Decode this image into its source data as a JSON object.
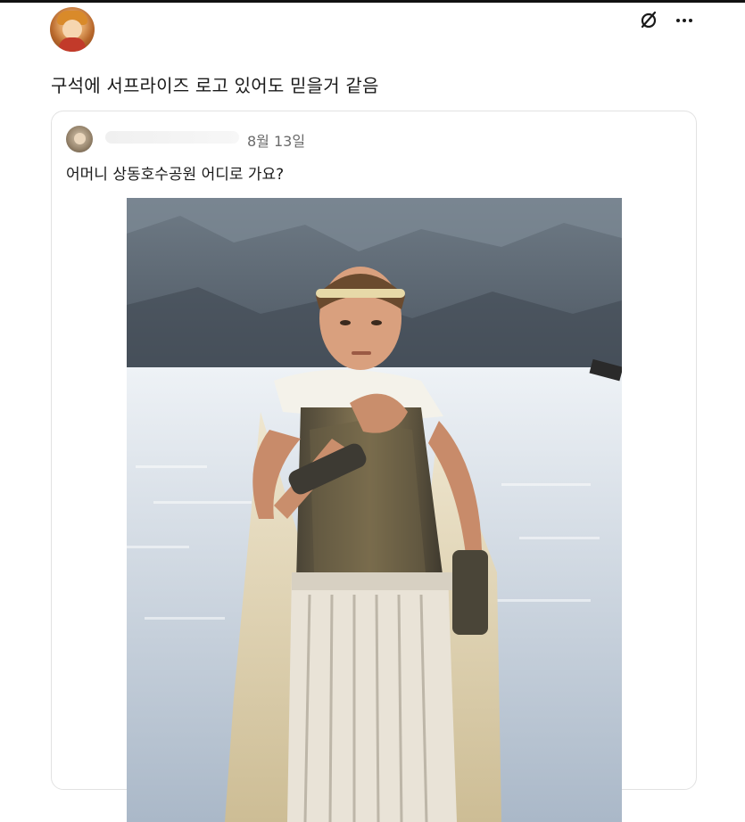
{
  "post": {
    "text": "구석에 서프라이즈 로고 있어도 믿을거 같음",
    "avatar_icon": "user-avatar"
  },
  "header_icons": {
    "edit_icon": "slashed-circle-icon",
    "more_icon": "more-dots-icon",
    "more_glyph": "···"
  },
  "quote": {
    "date": "8월 13일",
    "text": "어머니 상동호수공원 어디로 가요?",
    "avatar_icon": "user-avatar"
  },
  "colors": {
    "text": "#1a1a1a",
    "muted": "#6b6b6b",
    "border": "#e2e2e2"
  }
}
